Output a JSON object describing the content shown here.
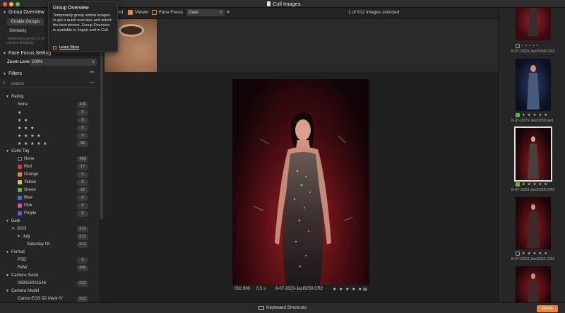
{
  "window": {
    "title": "Cull Images"
  },
  "toolbar": {
    "grid_label": "rid",
    "viewer_label": "Viewer",
    "face_focus_label": "Face Focus",
    "sort_value": "Date",
    "sort_direction": "▲",
    "selection_status": "1 of 512 images selected"
  },
  "tooltip": {
    "title": "Group Overview",
    "body": "Temporarily group similar images to get a quick overview and select the best photos. Group Overview is available in Import and in Cull.",
    "link": "Learn More"
  },
  "sidebar": {
    "group_overview": {
      "title": "Group Overview",
      "enable_label": "Enable Groups",
      "similarity_label": "Similarity",
      "blurb": "Temporarily group yo on content similarity."
    },
    "face_focus": {
      "title": "Face Focus Setting",
      "zoom_label": "Zoom Level",
      "zoom_value": "100%"
    },
    "filters": {
      "title": "Filters",
      "menu": "•••",
      "search_placeholder": "Search",
      "search_clear": "—"
    },
    "rating": {
      "title": "Rating",
      "items": [
        {
          "label": "None",
          "count": "426"
        },
        {
          "label": "★",
          "count": "0"
        },
        {
          "label": "★ ★",
          "count": "0"
        },
        {
          "label": "★ ★ ★",
          "count": "0"
        },
        {
          "label": "★ ★ ★ ★",
          "count": "0"
        },
        {
          "label": "★ ★ ★ ★ ★",
          "count": "86"
        }
      ]
    },
    "color_tag": {
      "title": "Color Tag",
      "items": [
        {
          "label": "None",
          "count": "483",
          "color": "none"
        },
        {
          "label": "Red",
          "count": "17",
          "color": "#d23b3b"
        },
        {
          "label": "Orange",
          "count": "0",
          "color": "#e08a2e"
        },
        {
          "label": "Yellow",
          "count": "0",
          "color": "#d8c23a"
        },
        {
          "label": "Green",
          "count": "12",
          "color": "#5fb43a"
        },
        {
          "label": "Blue",
          "count": "0",
          "color": "#3a6fd8"
        },
        {
          "label": "Pink",
          "count": "0",
          "color": "#d84fb4"
        },
        {
          "label": "Purple",
          "count": "0",
          "color": "#7a4fd8"
        }
      ]
    },
    "date": {
      "title": "Date",
      "items": [
        {
          "label": "2023",
          "count": "512"
        },
        {
          "label": "July",
          "count": "512"
        },
        {
          "label": "Saturday 08",
          "count": "512"
        }
      ]
    },
    "format": {
      "title": "Format",
      "items": [
        {
          "label": "PSD",
          "count": "6"
        },
        {
          "label": "RAW",
          "count": "506"
        }
      ]
    },
    "camera_serial": {
      "title": "Camera Serial",
      "items": [
        {
          "label": "083054001546",
          "count": "512"
        }
      ]
    },
    "camera_model": {
      "title": "Camera Model",
      "items": [
        {
          "label": "Canon EOS 5D Mark IV",
          "count": "512"
        }
      ]
    }
  },
  "viewer": {
    "iso": "ISO 800",
    "shutter": "0.5 s",
    "filename": "8-07-2023-Jazi0250.CR2",
    "stars": "★ ★ ★ ★ ★"
  },
  "filmstrip": {
    "items": [
      {
        "filename": "8-07-2023-Jazi0248.CR2",
        "stars": "• • • • •",
        "tag": "none"
      },
      {
        "filename": "8-07-2023-Jazi0250.psd",
        "stars": "★ ★ ★ ★ ★",
        "tag": "green"
      },
      {
        "filename": "8-07-2023-Jazi0250.CR2",
        "stars": "★ ★ ★ ★ ★",
        "tag": "green"
      },
      {
        "filename": "8-07-2023-Jazi0251.CR2",
        "stars": "★ ★ ★ ★ ★",
        "tag": "none"
      }
    ]
  },
  "bottombar": {
    "shortcuts_label": "Keyboard Shortcuts",
    "done_label": "Done"
  },
  "colors": {
    "accent": "#e8873a",
    "green_tag": "#5fb43a"
  }
}
